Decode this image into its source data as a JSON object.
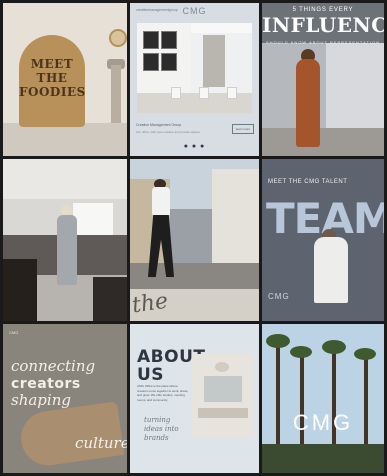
{
  "tiles": {
    "t1": {
      "sign": "MEET THE FOODIES"
    },
    "t2": {
      "brand": "CMG",
      "brand_left": "creativemanagementgroup",
      "line1": "Creative Management Group",
      "line2": "Our office, with open studios and private spaces.",
      "button": "learn more",
      "dots": "● ● ●"
    },
    "t3": {
      "kicker": "5 THINGS EVERY",
      "headline": "INFLUENCER",
      "sub": "SHOULD KNOW ABOUT REPRESENTATION"
    },
    "t4": {},
    "t5": {
      "banner": "the"
    },
    "t6": {
      "kicker": "MEET THE CMG TALENT",
      "headline": "TEAM",
      "logo": "CMG"
    },
    "t7": {
      "mark": "CMG",
      "w1": "connecting",
      "w2": "creators",
      "w3": "shaping",
      "w4": "culture"
    },
    "t8": {
      "headline1": "ABOUT",
      "headline2": "US",
      "body": "CMG Office is the place where creators come together to work, share, and grow. We offer studios, meeting rooms, and community.",
      "script": "turning ideas into brands"
    },
    "t9": {
      "logo": "CMG"
    }
  }
}
